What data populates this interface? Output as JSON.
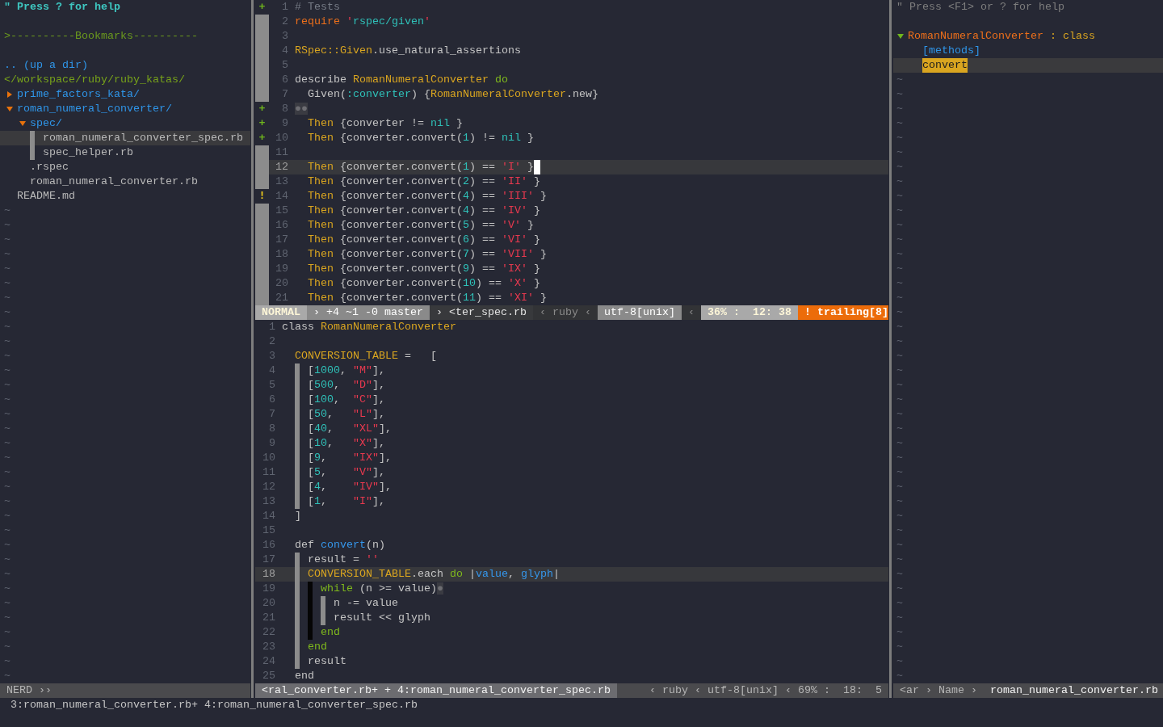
{
  "nerdtree": {
    "help": "\" Press ? for help",
    "bookmarks": ">----------Bookmarks----------",
    "up_dir": ".. (up a dir)",
    "root": "</workspace/ruby/ruby_katas/",
    "tree": [
      {
        "name": "prime_factors_kata/",
        "kind": "dir",
        "expanded": false,
        "selected": false
      },
      {
        "name": "roman_numeral_converter/",
        "kind": "dir",
        "expanded": true,
        "selected": false,
        "children": [
          {
            "name": "spec/",
            "kind": "dir",
            "expanded": true,
            "selected": false,
            "children": [
              {
                "name": "roman_numeral_converter_spec.rb",
                "kind": "file",
                "selected": true
              },
              {
                "name": "spec_helper.rb",
                "kind": "file",
                "selected": false
              }
            ]
          },
          {
            "name": ".rspec",
            "kind": "file",
            "selected": false
          },
          {
            "name": "roman_numeral_converter.rb",
            "kind": "file",
            "selected": false
          }
        ]
      },
      {
        "name": "README.md",
        "kind": "file",
        "selected": false
      }
    ],
    "empty_lines": [
      "~",
      "~",
      "~",
      "~",
      "~",
      "~",
      "~",
      "~",
      "~",
      "~",
      "~",
      "~",
      "~",
      "~",
      "~",
      "~",
      "~",
      "~",
      "~",
      "~",
      "~",
      "~",
      "~",
      "~",
      "~",
      "~",
      "~",
      "~",
      "~",
      "~",
      "~",
      "~",
      "~"
    ],
    "status": [
      {
        "kind": "inactive",
        "text": "NERD ››"
      }
    ]
  },
  "top_pane": {
    "active": true,
    "lines": [
      {
        "number": "1",
        "current": false,
        "sign": {
          "kind": "added",
          "text": "+"
        },
        "tokens": [
          {
            "kind": "comment",
            "text": "# Tests"
          }
        ]
      },
      {
        "number": "2",
        "current": false,
        "tokens": [
          {
            "kind": "kw",
            "text": "require "
          },
          {
            "kind": "str",
            "text": "'"
          },
          {
            "kind": "strc",
            "text": "rspec/given"
          },
          {
            "kind": "str",
            "text": "'"
          }
        ]
      },
      {
        "number": "3",
        "current": false
      },
      {
        "number": "4",
        "current": false,
        "tokens": [
          {
            "kind": "const",
            "text": "RSpec::Given"
          },
          {
            "kind": "plain",
            "text": ".use_natural_assertions"
          }
        ]
      },
      {
        "number": "5",
        "current": false
      },
      {
        "number": "6",
        "current": false,
        "tokens": [
          {
            "kind": "plain",
            "text": "describe "
          },
          {
            "kind": "const",
            "text": "RomanNumeralConverter"
          },
          {
            "kind": "block",
            "text": " do"
          }
        ]
      },
      {
        "number": "7",
        "current": false,
        "tokens": [
          {
            "kind": "plain",
            "text": "  Given("
          },
          {
            "kind": "num",
            "text": ":converter"
          },
          {
            "kind": "plain",
            "text": ") {"
          },
          {
            "kind": "const",
            "text": "RomanNumeralConverter"
          },
          {
            "kind": "plain",
            "text": ".new}"
          }
        ]
      },
      {
        "number": "8",
        "current": false,
        "sign": {
          "kind": "added",
          "text": "+"
        },
        "tokens": [
          {
            "kind": "ws",
            "text": "●●"
          }
        ]
      },
      {
        "number": "9",
        "current": false,
        "sign": {
          "kind": "added",
          "text": "+"
        },
        "tokens": [
          {
            "kind": "const",
            "text": "  Then"
          },
          {
            "kind": "plain",
            "text": " {converter != "
          },
          {
            "kind": "num",
            "text": "nil"
          },
          {
            "kind": "plain",
            "text": " }"
          }
        ]
      },
      {
        "number": "10",
        "current": false,
        "sign": {
          "kind": "added",
          "text": "+"
        },
        "tokens": [
          {
            "kind": "const",
            "text": "  Then"
          },
          {
            "kind": "plain",
            "text": " {converter.convert("
          },
          {
            "kind": "num",
            "text": "1"
          },
          {
            "kind": "plain",
            "text": ") != "
          },
          {
            "kind": "num",
            "text": "nil"
          },
          {
            "kind": "plain",
            "text": " }"
          }
        ]
      },
      {
        "number": "11",
        "current": false
      },
      {
        "number": "12",
        "current": true,
        "tokens": [
          {
            "kind": "const",
            "text": "  Then"
          },
          {
            "kind": "plain",
            "text": " {converter.convert("
          },
          {
            "kind": "num",
            "text": "1"
          },
          {
            "kind": "plain",
            "text": ") == "
          },
          {
            "kind": "str",
            "text": "'I'"
          },
          {
            "kind": "plain",
            "text": " }"
          }
        ]
      },
      {
        "number": "13",
        "current": false,
        "tokens": [
          {
            "kind": "const",
            "text": "  Then"
          },
          {
            "kind": "plain",
            "text": " {converter.convert("
          },
          {
            "kind": "num",
            "text": "2"
          },
          {
            "kind": "plain",
            "text": ") == "
          },
          {
            "kind": "str",
            "text": "'II'"
          },
          {
            "kind": "plain",
            "text": " }"
          }
        ]
      },
      {
        "number": "14",
        "current": false,
        "sign": {
          "kind": "warning",
          "text": "!"
        },
        "tokens": [
          {
            "kind": "const",
            "text": "  Then"
          },
          {
            "kind": "plain",
            "text": " {converter.convert("
          },
          {
            "kind": "num",
            "text": "4"
          },
          {
            "kind": "plain",
            "text": ") == "
          },
          {
            "kind": "str",
            "text": "'III'"
          },
          {
            "kind": "plain",
            "text": " }"
          }
        ]
      },
      {
        "number": "15",
        "current": false,
        "tokens": [
          {
            "kind": "const",
            "text": "  Then"
          },
          {
            "kind": "plain",
            "text": " {converter.convert("
          },
          {
            "kind": "num",
            "text": "4"
          },
          {
            "kind": "plain",
            "text": ") == "
          },
          {
            "kind": "str",
            "text": "'IV'"
          },
          {
            "kind": "plain",
            "text": " }"
          }
        ]
      },
      {
        "number": "16",
        "current": false,
        "tokens": [
          {
            "kind": "const",
            "text": "  Then"
          },
          {
            "kind": "plain",
            "text": " {converter.convert("
          },
          {
            "kind": "num",
            "text": "5"
          },
          {
            "kind": "plain",
            "text": ") == "
          },
          {
            "kind": "str",
            "text": "'V'"
          },
          {
            "kind": "plain",
            "text": " }"
          }
        ]
      },
      {
        "number": "17",
        "current": false,
        "tokens": [
          {
            "kind": "const",
            "text": "  Then"
          },
          {
            "kind": "plain",
            "text": " {converter.convert("
          },
          {
            "kind": "num",
            "text": "6"
          },
          {
            "kind": "plain",
            "text": ") == "
          },
          {
            "kind": "str",
            "text": "'VI'"
          },
          {
            "kind": "plain",
            "text": " }"
          }
        ]
      },
      {
        "number": "18",
        "current": false,
        "tokens": [
          {
            "kind": "const",
            "text": "  Then"
          },
          {
            "kind": "plain",
            "text": " {converter.convert("
          },
          {
            "kind": "num",
            "text": "7"
          },
          {
            "kind": "plain",
            "text": ") == "
          },
          {
            "kind": "str",
            "text": "'VII'"
          },
          {
            "kind": "plain",
            "text": " }"
          }
        ]
      },
      {
        "number": "19",
        "current": false,
        "tokens": [
          {
            "kind": "const",
            "text": "  Then"
          },
          {
            "kind": "plain",
            "text": " {converter.convert("
          },
          {
            "kind": "num",
            "text": "9"
          },
          {
            "kind": "plain",
            "text": ") == "
          },
          {
            "kind": "str",
            "text": "'IX'"
          },
          {
            "kind": "plain",
            "text": " }"
          }
        ]
      },
      {
        "number": "20",
        "current": false,
        "tokens": [
          {
            "kind": "const",
            "text": "  Then"
          },
          {
            "kind": "plain",
            "text": " {converter.convert("
          },
          {
            "kind": "num",
            "text": "10"
          },
          {
            "kind": "plain",
            "text": ") == "
          },
          {
            "kind": "str",
            "text": "'X'"
          },
          {
            "kind": "plain",
            "text": " }"
          }
        ]
      },
      {
        "number": "21",
        "current": false,
        "tokens": [
          {
            "kind": "const",
            "text": "  Then"
          },
          {
            "kind": "plain",
            "text": " {converter.convert("
          },
          {
            "kind": "num",
            "text": "11"
          },
          {
            "kind": "plain",
            "text": ") == "
          },
          {
            "kind": "str",
            "text": "'XI'"
          },
          {
            "kind": "plain",
            "text": " }"
          }
        ]
      }
    ],
    "status": [
      {
        "kind": "mode",
        "text": "NORMAL"
      },
      {
        "kind": "light",
        "text": "› +4 ~1 -0 master"
      },
      {
        "kind": "dark",
        "text": "› <ter_spec.rb"
      },
      {
        "kind": "spacer"
      },
      {
        "kind": "dim",
        "text": "‹ ruby ‹"
      },
      {
        "kind": "light",
        "text": "utf-8[unix]"
      },
      {
        "kind": "dim",
        "text": "‹"
      },
      {
        "kind": "mode",
        "text": "36% :  12: 38"
      },
      {
        "kind": "warn",
        "text": "! trailing[8]"
      }
    ]
  },
  "bottom_pane": {
    "active": false,
    "lines": [
      {
        "number": "1",
        "current": false,
        "tokens": [
          {
            "kind": "plain",
            "text": "class "
          },
          {
            "kind": "const",
            "text": "RomanNumeralConverter"
          }
        ]
      },
      {
        "number": "2",
        "current": false
      },
      {
        "number": "3",
        "current": false,
        "tokens": [
          {
            "kind": "const",
            "text": "  CONVERSION_TABLE"
          },
          {
            "kind": "plain",
            "text": " =   ["
          }
        ]
      },
      {
        "number": "4",
        "current": false,
        "guides": [
          {
            "dark": false
          }
        ],
        "tokens": [
          {
            "kind": "plain",
            "text": "["
          },
          {
            "kind": "num",
            "text": "1000"
          },
          {
            "kind": "plain",
            "text": ", "
          },
          {
            "kind": "str",
            "text": "\"M\""
          },
          {
            "kind": "plain",
            "text": "],"
          }
        ]
      },
      {
        "number": "5",
        "current": false,
        "guides": [
          {
            "dark": false
          }
        ],
        "tokens": [
          {
            "kind": "plain",
            "text": "["
          },
          {
            "kind": "num",
            "text": "500"
          },
          {
            "kind": "plain",
            "text": ",  "
          },
          {
            "kind": "str",
            "text": "\"D\""
          },
          {
            "kind": "plain",
            "text": "],"
          }
        ]
      },
      {
        "number": "6",
        "current": false,
        "guides": [
          {
            "dark": false
          }
        ],
        "tokens": [
          {
            "kind": "plain",
            "text": "["
          },
          {
            "kind": "num",
            "text": "100"
          },
          {
            "kind": "plain",
            "text": ",  "
          },
          {
            "kind": "str",
            "text": "\"C\""
          },
          {
            "kind": "plain",
            "text": "],"
          }
        ]
      },
      {
        "number": "7",
        "current": false,
        "guides": [
          {
            "dark": false
          }
        ],
        "tokens": [
          {
            "kind": "plain",
            "text": "["
          },
          {
            "kind": "num",
            "text": "50"
          },
          {
            "kind": "plain",
            "text": ",   "
          },
          {
            "kind": "str",
            "text": "\"L\""
          },
          {
            "kind": "plain",
            "text": "],"
          }
        ]
      },
      {
        "number": "8",
        "current": false,
        "guides": [
          {
            "dark": false
          }
        ],
        "tokens": [
          {
            "kind": "plain",
            "text": "["
          },
          {
            "kind": "num",
            "text": "40"
          },
          {
            "kind": "plain",
            "text": ",   "
          },
          {
            "kind": "str",
            "text": "\"XL\""
          },
          {
            "kind": "plain",
            "text": "],"
          }
        ]
      },
      {
        "number": "9",
        "current": false,
        "guides": [
          {
            "dark": false
          }
        ],
        "tokens": [
          {
            "kind": "plain",
            "text": "["
          },
          {
            "kind": "num",
            "text": "10"
          },
          {
            "kind": "plain",
            "text": ",   "
          },
          {
            "kind": "str",
            "text": "\"X\""
          },
          {
            "kind": "plain",
            "text": "],"
          }
        ]
      },
      {
        "number": "10",
        "current": false,
        "guides": [
          {
            "dark": false
          }
        ],
        "tokens": [
          {
            "kind": "plain",
            "text": "["
          },
          {
            "kind": "num",
            "text": "9"
          },
          {
            "kind": "plain",
            "text": ",    "
          },
          {
            "kind": "str",
            "text": "\"IX\""
          },
          {
            "kind": "plain",
            "text": "],"
          }
        ]
      },
      {
        "number": "11",
        "current": false,
        "guides": [
          {
            "dark": false
          }
        ],
        "tokens": [
          {
            "kind": "plain",
            "text": "["
          },
          {
            "kind": "num",
            "text": "5"
          },
          {
            "kind": "plain",
            "text": ",    "
          },
          {
            "kind": "str",
            "text": "\"V\""
          },
          {
            "kind": "plain",
            "text": "],"
          }
        ]
      },
      {
        "number": "12",
        "current": false,
        "guides": [
          {
            "dark": false
          }
        ],
        "tokens": [
          {
            "kind": "plain",
            "text": "["
          },
          {
            "kind": "num",
            "text": "4"
          },
          {
            "kind": "plain",
            "text": ",    "
          },
          {
            "kind": "str",
            "text": "\"IV\""
          },
          {
            "kind": "plain",
            "text": "],"
          }
        ]
      },
      {
        "number": "13",
        "current": false,
        "guides": [
          {
            "dark": false
          }
        ],
        "tokens": [
          {
            "kind": "plain",
            "text": "["
          },
          {
            "kind": "num",
            "text": "1"
          },
          {
            "kind": "plain",
            "text": ",    "
          },
          {
            "kind": "str",
            "text": "\"I\""
          },
          {
            "kind": "plain",
            "text": "],"
          }
        ]
      },
      {
        "number": "14",
        "current": false,
        "tokens": [
          {
            "kind": "plain",
            "text": "  ]"
          }
        ]
      },
      {
        "number": "15",
        "current": false
      },
      {
        "number": "16",
        "current": false,
        "tokens": [
          {
            "kind": "plain",
            "text": "  def "
          },
          {
            "kind": "method",
            "text": "convert"
          },
          {
            "kind": "plain",
            "text": "(n)"
          }
        ]
      },
      {
        "number": "17",
        "current": false,
        "guides": [
          {
            "dark": false
          }
        ],
        "tokens": [
          {
            "kind": "plain",
            "text": "result = "
          },
          {
            "kind": "str",
            "text": "''"
          }
        ]
      },
      {
        "number": "18",
        "current": true,
        "guides": [
          {
            "dark": false
          }
        ],
        "tokens": [
          {
            "kind": "const",
            "text": "CONVERSION_TABLE"
          },
          {
            "kind": "plain",
            "text": ".each "
          },
          {
            "kind": "block",
            "text": "do"
          },
          {
            "kind": "plain",
            "text": " |"
          },
          {
            "kind": "method",
            "text": "value"
          },
          {
            "kind": "plain",
            "text": ", "
          },
          {
            "kind": "method",
            "text": "glyph"
          },
          {
            "kind": "plain",
            "text": "|"
          }
        ]
      },
      {
        "number": "19",
        "current": false,
        "guides": [
          {
            "dark": false
          },
          {
            "dark": true
          }
        ],
        "tokens": [
          {
            "kind": "block",
            "text": "while"
          },
          {
            "kind": "plain",
            "text": " (n >= value)"
          },
          {
            "kind": "ws",
            "text": "●"
          }
        ]
      },
      {
        "number": "20",
        "current": false,
        "guides": [
          {
            "dark": false
          },
          {
            "dark": true
          },
          {
            "dark": false
          }
        ],
        "tokens": [
          {
            "kind": "plain",
            "text": "n -= value"
          }
        ]
      },
      {
        "number": "21",
        "current": false,
        "guides": [
          {
            "dark": false
          },
          {
            "dark": true
          },
          {
            "dark": false
          }
        ],
        "tokens": [
          {
            "kind": "plain",
            "text": "result << glyph"
          }
        ]
      },
      {
        "number": "22",
        "current": false,
        "guides": [
          {
            "dark": false
          },
          {
            "dark": true
          }
        ],
        "tokens": [
          {
            "kind": "block",
            "text": "end"
          }
        ]
      },
      {
        "number": "23",
        "current": false,
        "guides": [
          {
            "dark": false
          }
        ],
        "tokens": [
          {
            "kind": "block",
            "text": "end"
          }
        ]
      },
      {
        "number": "24",
        "current": false,
        "guides": [
          {
            "dark": false
          }
        ],
        "tokens": [
          {
            "kind": "plain",
            "text": "result"
          }
        ]
      },
      {
        "number": "25",
        "current": false,
        "tokens": [
          {
            "kind": "plain",
            "text": "  end"
          }
        ]
      }
    ],
    "status": [
      {
        "kind": "inactive_hi",
        "text": "<ral_converter.rb+ + 4:roman_numeral_converter_spec.rb"
      },
      {
        "kind": "spacer"
      },
      {
        "kind": "inactive",
        "text": "‹ ruby ‹ utf-8[unix] ‹ 69% :  18:  5"
      }
    ]
  },
  "tagbar": {
    "help": "\" Press <F1> or ? for help",
    "class": {
      "name": "RomanNumeralConverter",
      "type": ": class",
      "expanded": true
    },
    "group": "[methods]",
    "tags": [
      {
        "name": "convert",
        "selected": true
      }
    ],
    "empty_lines": [
      "~",
      "~",
      "~",
      "~",
      "~",
      "~",
      "~",
      "~",
      "~",
      "~",
      "~",
      "~",
      "~",
      "~",
      "~",
      "~",
      "~",
      "~",
      "~",
      "~",
      "~",
      "~",
      "~",
      "~",
      "~",
      "~",
      "~",
      "~",
      "~",
      "~",
      "~",
      "~",
      "~",
      "~",
      "~",
      "~",
      "~",
      "~",
      "~",
      "~",
      "~",
      "~"
    ],
    "status": [
      {
        "kind": "inactive",
        "text": "<ar › Name ›"
      },
      {
        "kind": "inactive_bright",
        "text": "roman_numeral_converter.rb"
      }
    ]
  },
  "command_line": "3:roman_numeral_converter.rb+ 4:roman_numeral_converter_spec.rb"
}
